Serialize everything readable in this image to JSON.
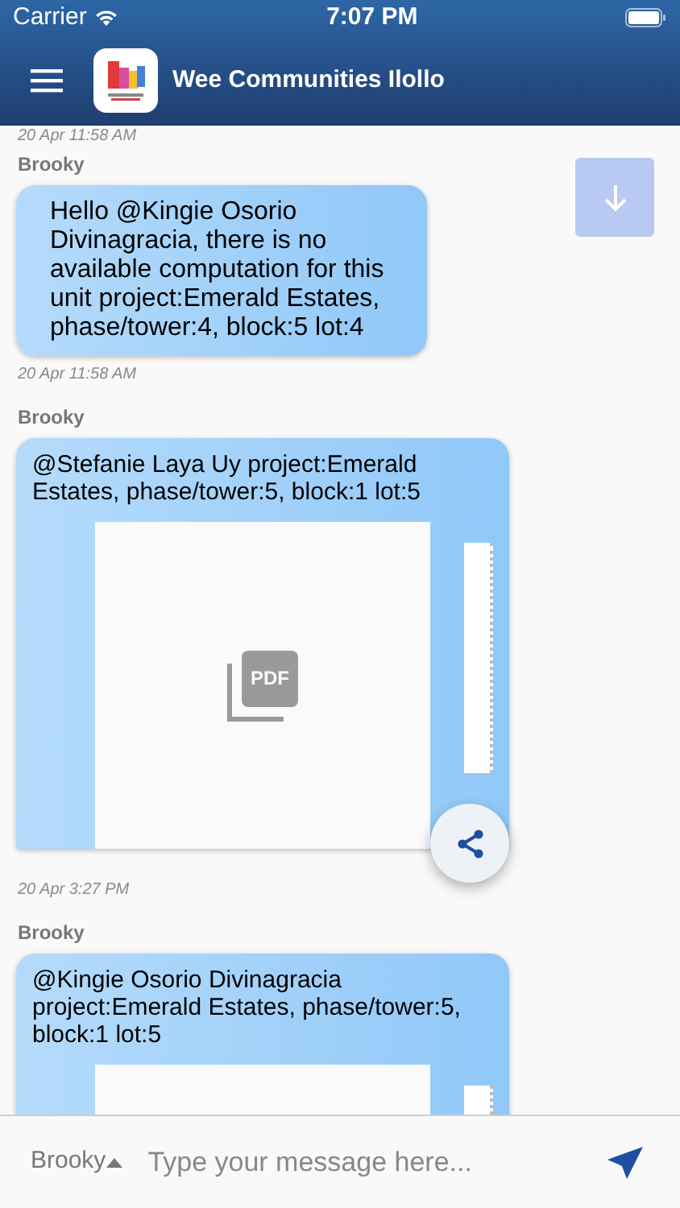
{
  "status_bar": {
    "carrier": "Carrier",
    "time": "7:07 PM"
  },
  "header": {
    "title": "Wee Communities Ilollo"
  },
  "top_timestamp": "20 Apr 11:58 AM",
  "messages": [
    {
      "sender": "Brooky",
      "kind": "text",
      "text": "Hello @Kingie Osorio Divinagracia, there is no available computation for this unit project:Emerald Estates, phase/tower:4, block:5 lot:4",
      "time": "20 Apr 11:58 AM"
    },
    {
      "sender": "Brooky",
      "kind": "pdf",
      "text": "@Stefanie Laya Uy project:Emerald Estates, phase/tower:5, block:1 lot:5",
      "file_label": "PDF",
      "time": "20 Apr 3:27 PM"
    },
    {
      "sender": "Brooky",
      "kind": "pdf_partial",
      "text": "@Kingie Osorio Divinagracia project:Emerald Estates, phase/tower:5, block:1 lot:5"
    }
  ],
  "composer": {
    "sender": "Brooky",
    "placeholder": "Type your message here..."
  }
}
